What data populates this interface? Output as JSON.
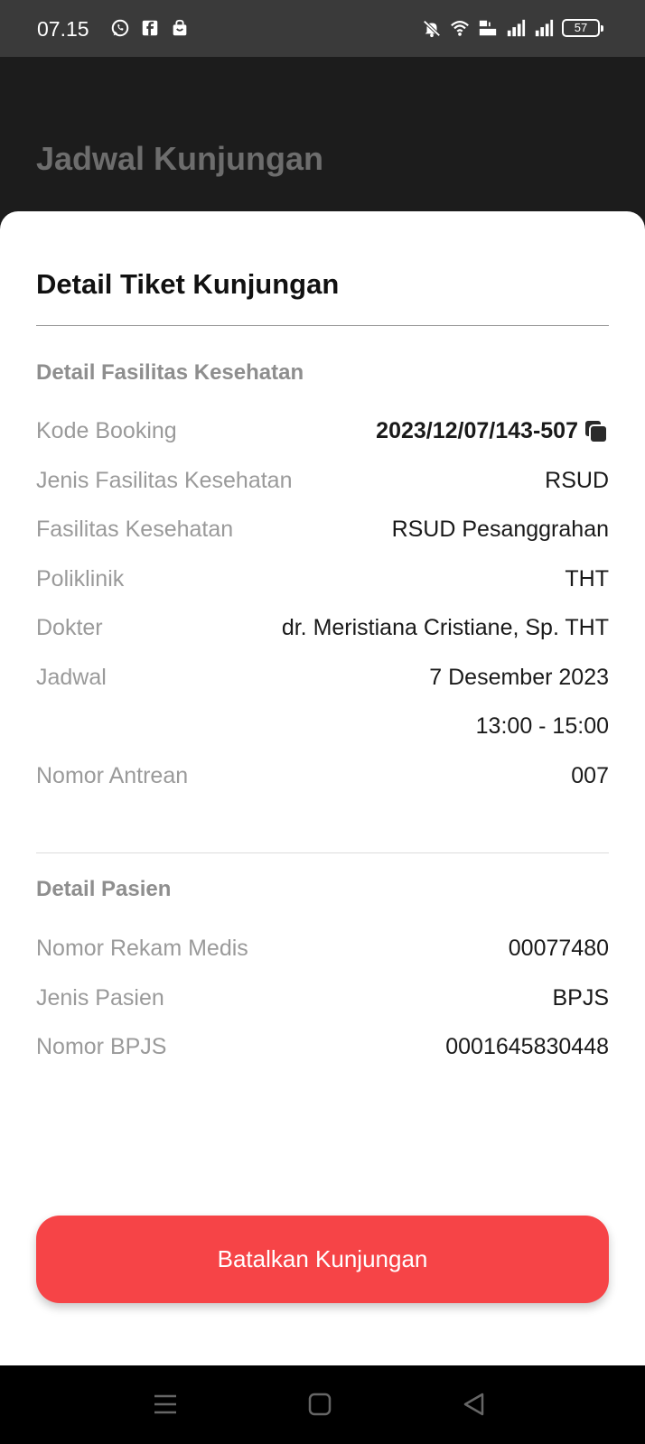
{
  "status_bar": {
    "time": "07.15",
    "left_icons": [
      "whatsapp-icon",
      "facebook-icon",
      "shopping-bag-icon"
    ],
    "right_icons": [
      "mute-icon",
      "wifi-icon",
      "volte-icon",
      "signal-icon",
      "signal-icon"
    ],
    "battery": "57"
  },
  "appbar": {
    "title": "Jadwal Kunjungan"
  },
  "sheet": {
    "title": "Detail Tiket Kunjungan",
    "facility_section": {
      "title": "Detail Fasilitas Kesehatan",
      "rows": [
        {
          "label": "Kode Booking",
          "value": "2023/12/07/143-507"
        },
        {
          "label": "Jenis Fasilitas Kesehatan",
          "value": "RSUD"
        },
        {
          "label": "Fasilitas Kesehatan",
          "value": "RSUD Pesanggrahan"
        },
        {
          "label": "Poliklinik",
          "value": "THT"
        },
        {
          "label": "Dokter",
          "value": "dr. Meristiana Cristiane, Sp. THT"
        },
        {
          "label": "Jadwal",
          "value": "7 Desember 2023"
        },
        {
          "label": "",
          "value": "13:00 - 15:00"
        },
        {
          "label": "Nomor Antrean",
          "value": "007"
        }
      ]
    },
    "patient_section": {
      "title": "Detail Pasien",
      "rows": [
        {
          "label": "Nomor Rekam Medis",
          "value": "00077480"
        },
        {
          "label": "Jenis Pasien",
          "value": "BPJS"
        },
        {
          "label": "Nomor BPJS",
          "value": "0001645830448"
        }
      ]
    },
    "cancel_button": "Batalkan Kunjungan"
  },
  "nav_bar": {
    "icons": [
      "menu-icon",
      "home-icon",
      "back-icon"
    ]
  },
  "colors": {
    "accent": "#f64447",
    "appbar_bg": "#1c1c1c",
    "status_bg": "#3a3a3a"
  }
}
